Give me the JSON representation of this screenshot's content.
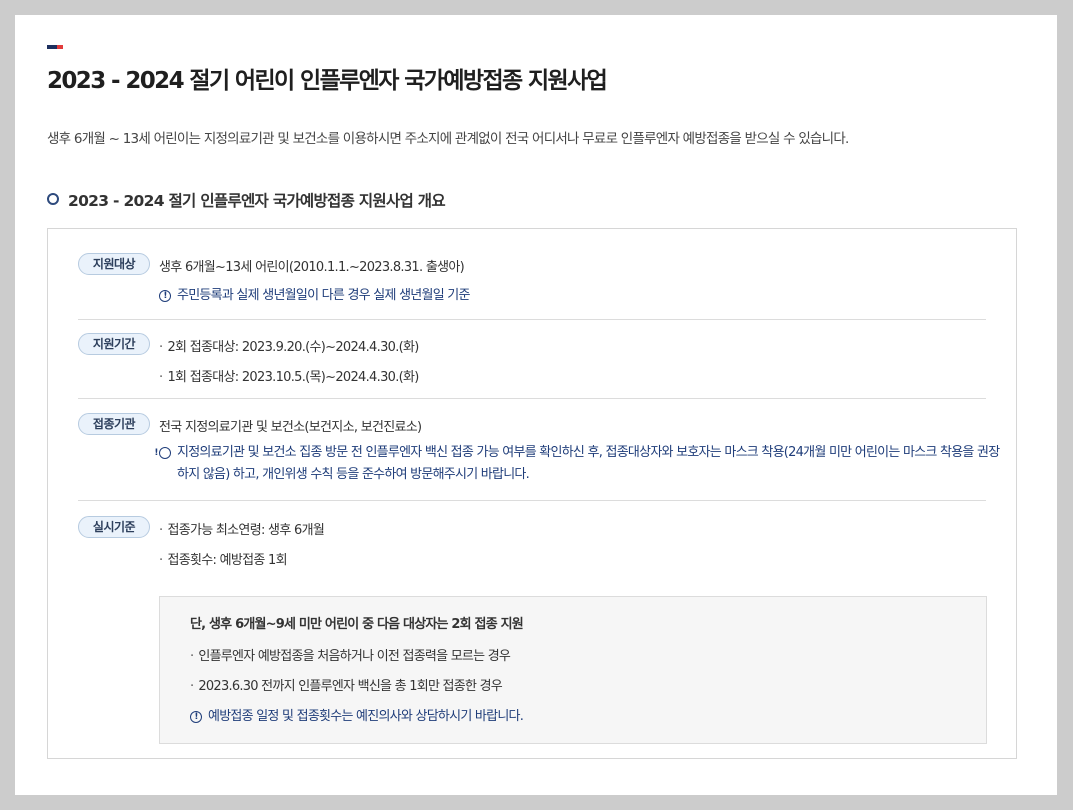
{
  "header": {
    "title": "2023 - 2024 절기 어린이 인플루엔자 국가예방접종 지원사업",
    "flag_colors": [
      "#1c2f5e",
      "#e23c3c"
    ]
  },
  "intro": "생후 6개월 ~ 13세 어린이는 지정의료기관 및 보건소를 이용하시면 주소지에 관계없이 전국 어디서나 무료로 인플루엔자 예방접종을 받으실 수 있습니다.",
  "section": {
    "heading": "2023 - 2024 절기 인플루엔자 국가예방접종 지원사업 개요",
    "rows": {
      "target": {
        "badge": "지원대상",
        "text": "생후 6개월~13세 어린이(2010.1.1.~2023.8.31. 출생아)",
        "note": "주민등록과 실제 생년월일이 다른 경우 실제 생년월일 기준"
      },
      "period": {
        "badge": "지원기간",
        "items": [
          "2회 접종대상: 2023.9.20.(수)~2024.4.30.(화)",
          "1회 접종대상: 2023.10.5.(목)~2024.4.30.(화)"
        ]
      },
      "institution": {
        "badge": "접종기관",
        "text": "전국 지정의료기관 및 보건소(보건지소, 보건진료소)",
        "note": "지정의료기관 및 보건소 집종 방문 전 인플루엔자 백신 접종 가능 여부를 확인하신 후, 접종대상자와 보호자는 마스크 착용(24개월 미만 어린이는 마스크 착용을 권장하지 않음) 하고, 개인위생 수칙 등을 준수하여 방문해주시기 바랍니다."
      },
      "criteria": {
        "badge": "실시기준",
        "items": [
          "접종가능 최소연령: 생후 6개월",
          "접종횟수: 예방접종 1회"
        ],
        "exception": {
          "title": "단, 생후 6개월~9세 미만 어린이 중 다음 대상자는 2회 접종 지원",
          "items": [
            "인플루엔자 예방접종을 처음하거나 이전 접종력을 모르는 경우",
            "2023.6.30 전까지 인플루엔자 백신을 총 1회만 접종한 경우"
          ],
          "note": "예방접종 일정 및 접종횟수는 예진의사와 상담하시기 바랍니다."
        }
      }
    }
  },
  "colors": {
    "accent": "#1f3d7a",
    "badge_bg": "#eaf2fb",
    "badge_border": "#b7cbe0"
  },
  "icons": {
    "info": "info-circle-icon",
    "bullet": "circle-bullet-icon"
  }
}
